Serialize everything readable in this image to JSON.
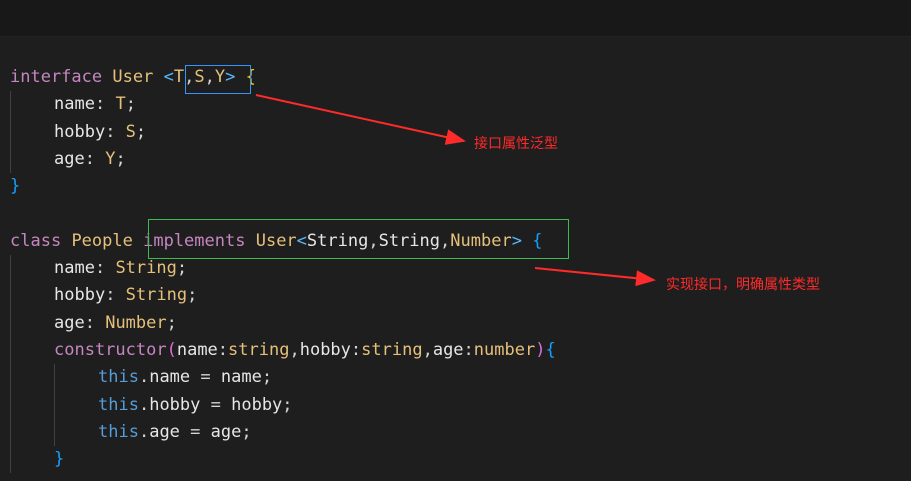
{
  "editor": {
    "lines": [
      {
        "indent": 0,
        "tokens": [
          {
            "t": "interface",
            "c": "kw"
          },
          {
            "t": " ",
            "c": "punc"
          },
          {
            "t": "User",
            "c": "cls"
          },
          {
            "t": " ",
            "c": "punc"
          },
          {
            "t": "<",
            "c": "ang"
          },
          {
            "t": "T",
            "c": "gen"
          },
          {
            "t": ",",
            "c": "punc"
          },
          {
            "t": "S",
            "c": "gen"
          },
          {
            "t": ",",
            "c": "punc"
          },
          {
            "t": "Y",
            "c": "gen"
          },
          {
            "t": ">",
            "c": "ang"
          },
          {
            "t": " ",
            "c": "punc"
          },
          {
            "t": "{",
            "c": "br1"
          }
        ]
      },
      {
        "indent": 1,
        "tokens": [
          {
            "t": "name",
            "c": "prop"
          },
          {
            "t": ": ",
            "c": "punc"
          },
          {
            "t": "T",
            "c": "gen"
          },
          {
            "t": ";",
            "c": "punc"
          }
        ]
      },
      {
        "indent": 1,
        "tokens": [
          {
            "t": "hobby",
            "c": "prop"
          },
          {
            "t": ": ",
            "c": "punc"
          },
          {
            "t": "S",
            "c": "gen"
          },
          {
            "t": ";",
            "c": "punc"
          }
        ]
      },
      {
        "indent": 1,
        "tokens": [
          {
            "t": "age",
            "c": "prop"
          },
          {
            "t": ": ",
            "c": "punc"
          },
          {
            "t": "Y",
            "c": "gen"
          },
          {
            "t": ";",
            "c": "punc"
          }
        ]
      },
      {
        "indent": 0,
        "tokens": [
          {
            "t": "}",
            "c": "br3"
          }
        ]
      },
      {
        "indent": 0,
        "tokens": []
      },
      {
        "indent": 0,
        "tokens": [
          {
            "t": "class",
            "c": "kw"
          },
          {
            "t": " ",
            "c": "punc"
          },
          {
            "t": "People",
            "c": "cls"
          },
          {
            "t": " ",
            "c": "punc"
          },
          {
            "t": "implements",
            "c": "kw"
          },
          {
            "t": " ",
            "c": "punc"
          },
          {
            "t": "User",
            "c": "cls"
          },
          {
            "t": "<",
            "c": "ang"
          },
          {
            "t": "String",
            "c": "prop"
          },
          {
            "t": ",",
            "c": "punc"
          },
          {
            "t": "String",
            "c": "prop"
          },
          {
            "t": ",",
            "c": "punc"
          },
          {
            "t": "Number",
            "c": "typ"
          },
          {
            "t": ">",
            "c": "ang"
          },
          {
            "t": " ",
            "c": "punc"
          },
          {
            "t": "{",
            "c": "br3"
          }
        ]
      },
      {
        "indent": 1,
        "tokens": [
          {
            "t": "name",
            "c": "prop"
          },
          {
            "t": ": ",
            "c": "punc"
          },
          {
            "t": "String",
            "c": "typ"
          },
          {
            "t": ";",
            "c": "punc"
          }
        ]
      },
      {
        "indent": 1,
        "tokens": [
          {
            "t": "hobby",
            "c": "prop"
          },
          {
            "t": ": ",
            "c": "punc"
          },
          {
            "t": "String",
            "c": "typ"
          },
          {
            "t": ";",
            "c": "punc"
          }
        ]
      },
      {
        "indent": 1,
        "tokens": [
          {
            "t": "age",
            "c": "prop"
          },
          {
            "t": ": ",
            "c": "punc"
          },
          {
            "t": "Number",
            "c": "typ"
          },
          {
            "t": ";",
            "c": "punc"
          }
        ]
      },
      {
        "indent": 1,
        "tokens": [
          {
            "t": "constructor",
            "c": "fn"
          },
          {
            "t": "(",
            "c": "br2"
          },
          {
            "t": "name",
            "c": "param"
          },
          {
            "t": ":",
            "c": "punc"
          },
          {
            "t": "string",
            "c": "typ"
          },
          {
            "t": ",",
            "c": "punc"
          },
          {
            "t": "hobby",
            "c": "param"
          },
          {
            "t": ":",
            "c": "punc"
          },
          {
            "t": "string",
            "c": "typ"
          },
          {
            "t": ",",
            "c": "punc"
          },
          {
            "t": "age",
            "c": "param"
          },
          {
            "t": ":",
            "c": "punc"
          },
          {
            "t": "number",
            "c": "typ"
          },
          {
            "t": ")",
            "c": "br2"
          },
          {
            "t": "{",
            "c": "br3"
          }
        ]
      },
      {
        "indent": 2,
        "tokens": [
          {
            "t": "this",
            "c": "thisk"
          },
          {
            "t": ".",
            "c": "punc"
          },
          {
            "t": "name",
            "c": "prop"
          },
          {
            "t": " = ",
            "c": "punc"
          },
          {
            "t": "name",
            "c": "param"
          },
          {
            "t": ";",
            "c": "punc"
          }
        ]
      },
      {
        "indent": 2,
        "tokens": [
          {
            "t": "this",
            "c": "thisk"
          },
          {
            "t": ".",
            "c": "punc"
          },
          {
            "t": "hobby",
            "c": "prop"
          },
          {
            "t": " = ",
            "c": "punc"
          },
          {
            "t": "hobby",
            "c": "param"
          },
          {
            "t": ";",
            "c": "punc"
          }
        ]
      },
      {
        "indent": 2,
        "tokens": [
          {
            "t": "this",
            "c": "thisk"
          },
          {
            "t": ".",
            "c": "punc"
          },
          {
            "t": "age",
            "c": "prop"
          },
          {
            "t": " = ",
            "c": "punc"
          },
          {
            "t": "age",
            "c": "param"
          },
          {
            "t": ";",
            "c": "punc"
          }
        ]
      },
      {
        "indent": 1,
        "tokens": [
          {
            "t": "}",
            "c": "br3"
          }
        ]
      }
    ]
  },
  "annotations": {
    "generic_props": "接口属性泛型",
    "implement_types": "实现接口，明确属性类型"
  },
  "colors": {
    "annotation": "#ff2a2a",
    "highlight_blue": "#3794ff",
    "highlight_green": "#3fba50"
  }
}
